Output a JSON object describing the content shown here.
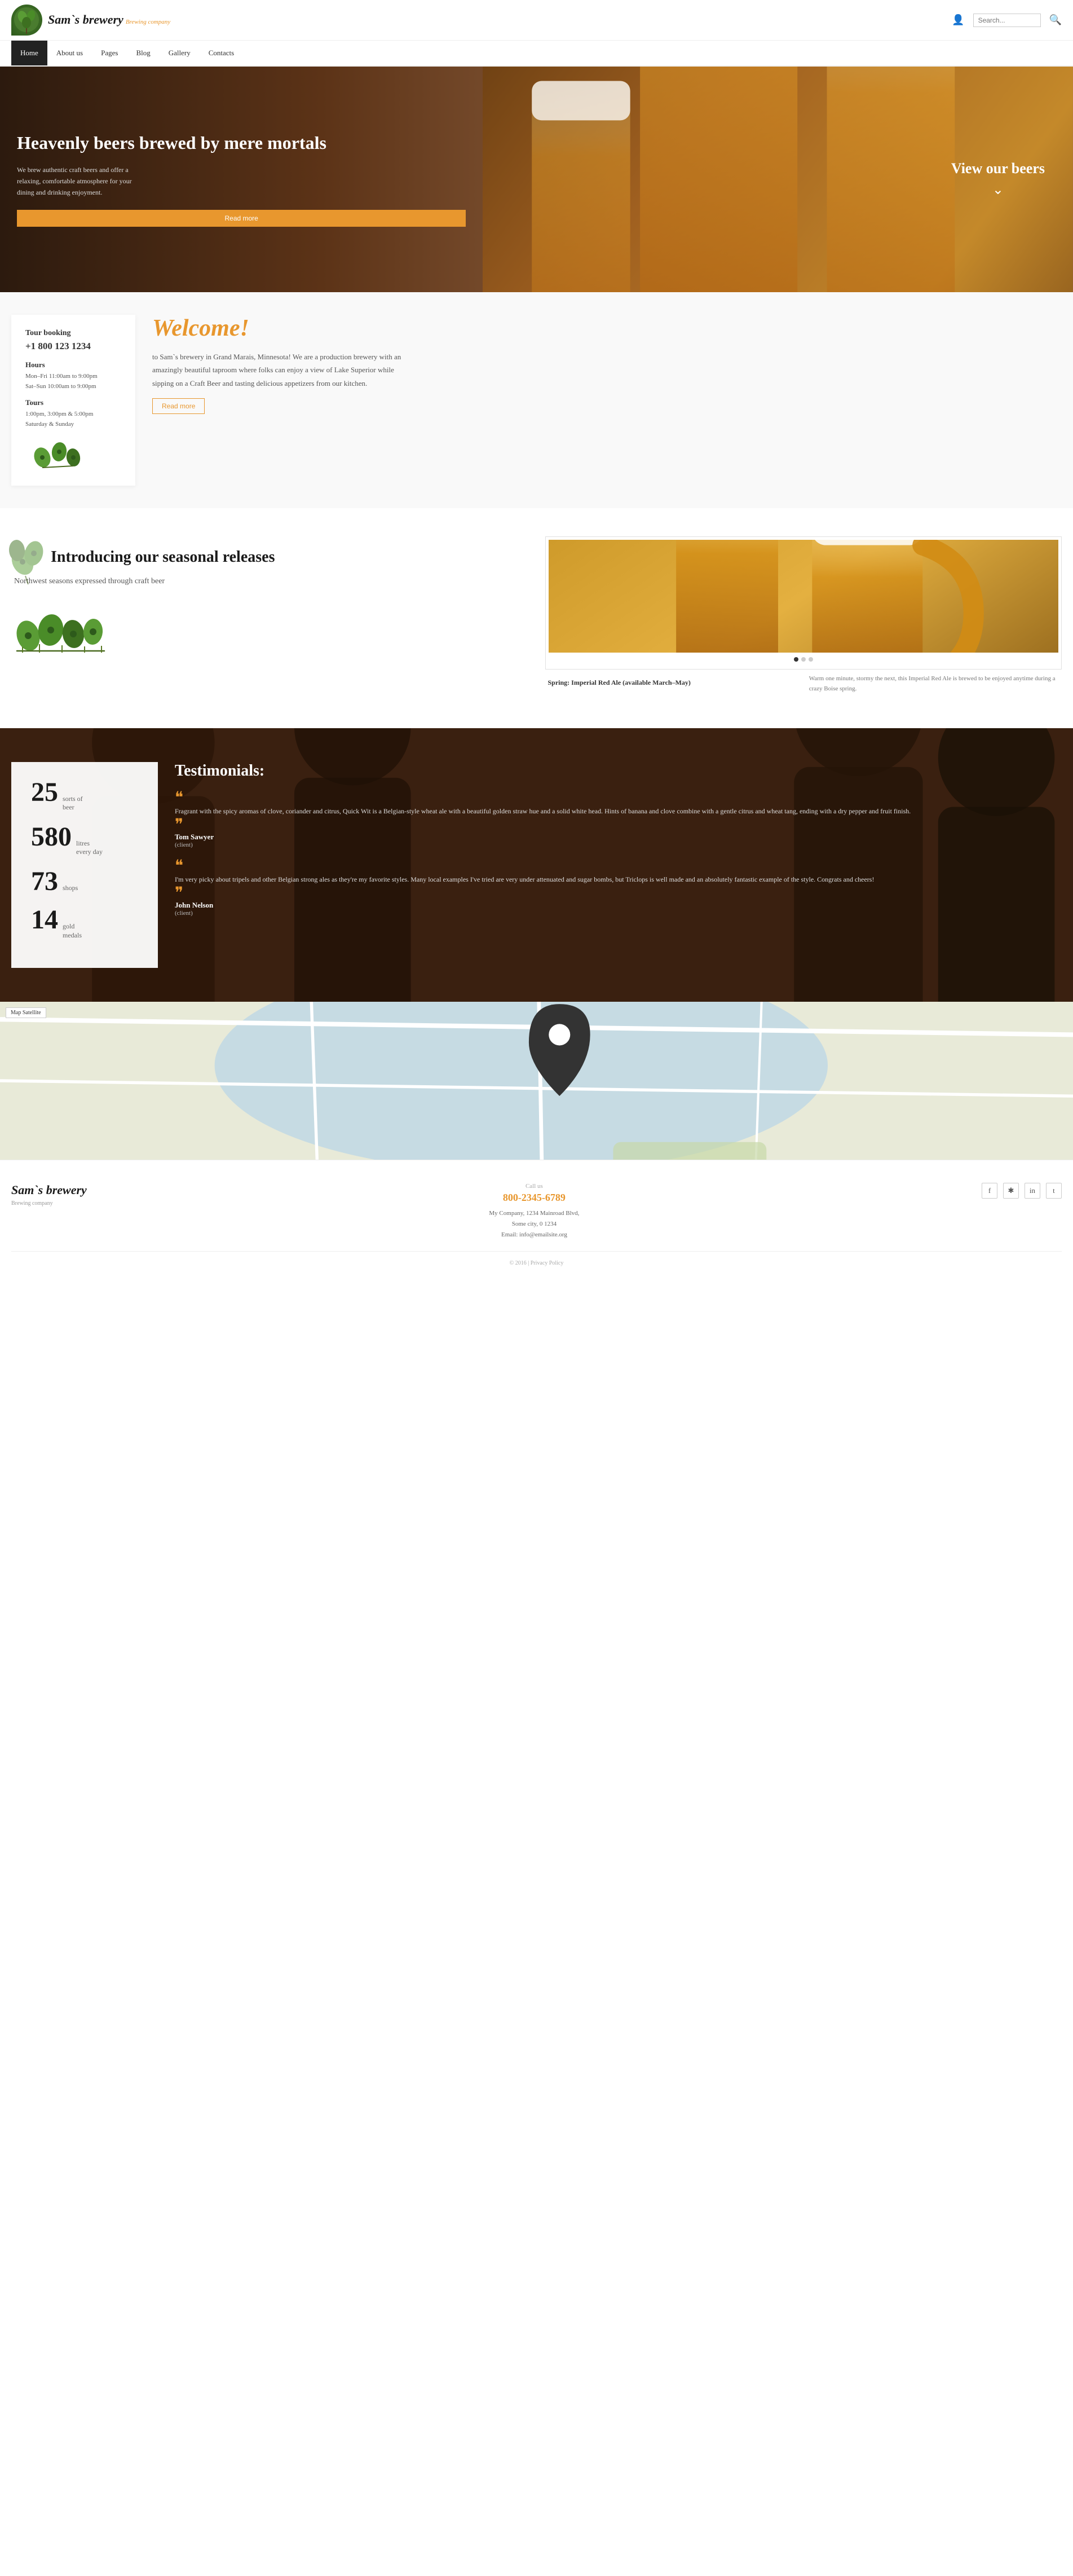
{
  "brand": {
    "name": "Sam`s brewery",
    "tagline": "Brewing company"
  },
  "nav": {
    "search_placeholder": "Search...",
    "items": [
      {
        "label": "Home",
        "active": true
      },
      {
        "label": "About us",
        "active": false
      },
      {
        "label": "Pages",
        "active": false
      },
      {
        "label": "Blog",
        "active": false
      },
      {
        "label": "Gallery",
        "active": false
      },
      {
        "label": "Contacts",
        "active": false
      }
    ]
  },
  "hero": {
    "headline": "Heavenly beers brewed by mere mortals",
    "description": "We brew authentic craft beers and offer a relaxing, comfortable atmosphere for your dining and drinking enjoyment.",
    "read_more": "Read more",
    "view_beers": "View our beers"
  },
  "tour_booking": {
    "title": "Tour booking",
    "phone": "+1 800 123 1234",
    "hours_title": "Hours",
    "hours_weekday": "Mon–Fri 11:00am to 9:00pm",
    "hours_weekend": "Sat–Sun 10:00am to 9:00pm",
    "tours_title": "Tours",
    "tours_times": "1:00pm, 3:00pm & 5:00pm",
    "tours_days": "Saturday & Sunday"
  },
  "welcome": {
    "title": "Welcome!",
    "text": "to Sam`s brewery in Grand Marais, Minnesota! We are a production brewery with an amazingly beautiful taproom where folks can enjoy a view of Lake Superior while sipping on a Craft Beer and tasting delicious appetizers from our kitchen.",
    "read_more": "Read more"
  },
  "seasonal": {
    "title": "Introducing our seasonal releases",
    "description": "Northwest seasons expressed through craft beer",
    "beer_name": "Spring: Imperial Red Ale (available March–May)",
    "beer_description": "Warm one minute, stormy the next, this Imperial Red Ale is brewed to be enjoyed anytime during a crazy Boise spring."
  },
  "stats": {
    "items": [
      {
        "number": "25",
        "label": "sorts of\nbeer"
      },
      {
        "number": "580",
        "label": "litres\nevery day"
      },
      {
        "number": "73",
        "label": "shops"
      },
      {
        "number": "14",
        "label": "gold\nmedals"
      }
    ]
  },
  "testimonials": {
    "title": "Testimonials:",
    "items": [
      {
        "text": "Fragrant with the spicy aromas of clove, coriander and citrus, Quick Wit is a Belgian-style wheat ale with a beautiful golden straw hue and a solid white head. Hints of banana and clove combine with a gentle citrus and wheat tang, ending with a dry pepper and fruit finish.",
        "author": "Tom Sawyer",
        "role": "(client)"
      },
      {
        "text": "I'm very picky about tripels and other Belgian strong ales as they're my favorite styles. Many local examples I've tried are very under attenuated and sugar bombs, but Triclops is well made and an absolutely fantastic example of the style. Congrats and cheers!",
        "author": "John Nelson",
        "role": "(client)"
      }
    ]
  },
  "footer": {
    "brand_name": "Sam`s brewery",
    "tagline": "Brewing company",
    "phone_label": "Call us",
    "phone": "800-2345-6789",
    "address_line1": "My Company, 1234 Mainroad Blvd,",
    "address_line2": "Some city, 0 1234",
    "email": "Email: info@emailsite.org",
    "copyright": "© 2016 | Privacy Policy",
    "social_icons": [
      "f",
      "✱",
      "in",
      "t"
    ]
  }
}
